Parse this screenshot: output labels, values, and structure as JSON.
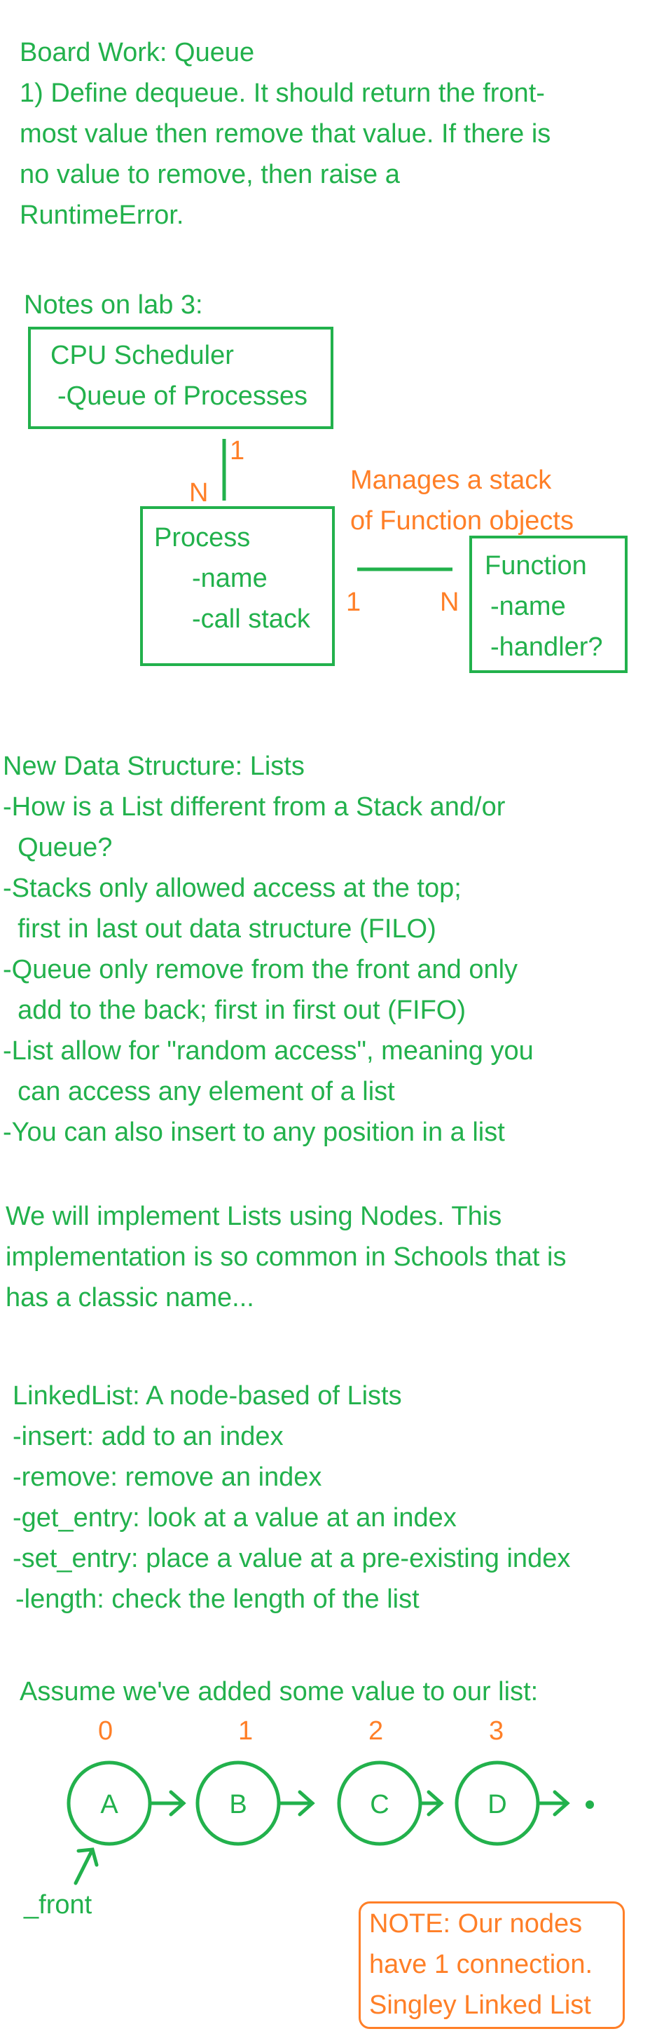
{
  "board": {
    "title": "Board Work: Queue",
    "lines": [
      "1) Define dequeue. It should return the front-",
      "most value then remove that value. If there is",
      "no value to remove, then raise a",
      "RuntimeError."
    ]
  },
  "lab_notes": {
    "heading": "Notes on lab 3:",
    "cpu_box": [
      "CPU Scheduler",
      "-Queue of Processes"
    ],
    "process_box": [
      "Process",
      "-name",
      "-call stack"
    ],
    "function_box": [
      "Function",
      "-name",
      "-handler?"
    ],
    "manages_note": [
      "Manages a stack",
      "of Function objects"
    ],
    "cardinality": {
      "cpu_side": "1",
      "process_top": "N",
      "process_right": "1",
      "function_left": "N"
    }
  },
  "lists": {
    "lines": [
      "New Data Structure: Lists",
      "-How is a List different from a Stack and/or",
      "  Queue?",
      "-Stacks only allowed access at the top;",
      "  first in last out data structure (FILO)",
      "-Queue only remove from the front and only",
      "  add to the back; first in first out (FIFO)",
      "-List allow for \"random access\", meaning you",
      "  can access any element of a list",
      "-You can also insert to any position in a list"
    ]
  },
  "nodes_intro": {
    "lines": [
      "We will implement Lists using Nodes. This",
      "implementation is so common in Schools that is",
      "has a classic name..."
    ]
  },
  "linked_list": {
    "lines": [
      "LinkedList: A node-based of Lists",
      "-insert: add to an index",
      "-remove: remove an index",
      "-get_entry: look at a value at an index",
      "-set_entry: place a value at a pre-existing index",
      "-length: check the length of the list"
    ]
  },
  "diagram": {
    "caption": "Assume we've added some value to our list:",
    "indices": [
      "0",
      "1",
      "2",
      "3"
    ],
    "nodes": [
      "A",
      "B",
      "C",
      "D"
    ],
    "front_label": "_front",
    "note": [
      "NOTE: Our nodes",
      "have 1 connection.",
      "Singley Linked List"
    ]
  },
  "colors": {
    "green": "#22b14c",
    "orange": "#ff7f27"
  }
}
